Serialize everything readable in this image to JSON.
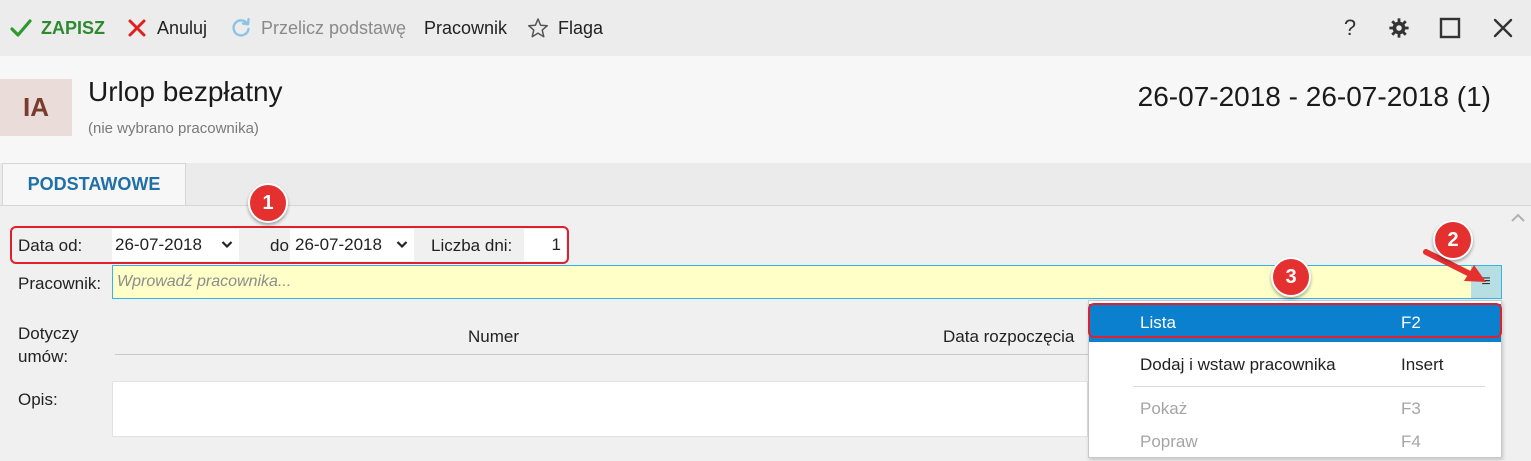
{
  "toolbar": {
    "save_label": "ZAPISZ",
    "cancel_label": "Anuluj",
    "recalc_label": "Przelicz podstawę",
    "employee_label": "Pracownik",
    "flag_label": "Flaga",
    "help_label": "?"
  },
  "header": {
    "avatar_initials": "IA",
    "title": "Urlop bezpłatny",
    "subtitle": "(nie wybrano pracownika)",
    "date_range": "26-07-2018 - 26-07-2018 (1)"
  },
  "tabs": [
    {
      "label": "PODSTAWOWE"
    }
  ],
  "form": {
    "date_from_label": "Data od:",
    "date_from_value": "26-07-2018",
    "date_to_label": "do:",
    "date_to_value": "26-07-2018",
    "days_label": "Liczba dni:",
    "days_value": "1",
    "employee_label": "Pracownik:",
    "employee_placeholder": "Wprowadź pracownika...",
    "contracts_label_line1": "Dotyczy",
    "contracts_label_line2": "umów:",
    "contracts_columns": [
      "Numer",
      "Data rozpoczęcia"
    ],
    "description_label": "Opis:"
  },
  "employee_menu": {
    "items": [
      {
        "label": "Lista",
        "shortcut": "F2"
      },
      {
        "label": "Dodaj i wstaw pracownika",
        "shortcut": "Insert"
      },
      {
        "label": "Pokaż",
        "shortcut": "F3"
      },
      {
        "label": "Popraw",
        "shortcut": "F4"
      }
    ]
  },
  "annotations": {
    "badge1": "1",
    "badge2": "2",
    "badge3": "3"
  },
  "colors": {
    "accent_blue": "#0a80cf",
    "save_green": "#2e9a2e",
    "cancel_red": "#e02020",
    "annotation_red": "#e53030",
    "employee_field_bg": "#ffffc8"
  }
}
